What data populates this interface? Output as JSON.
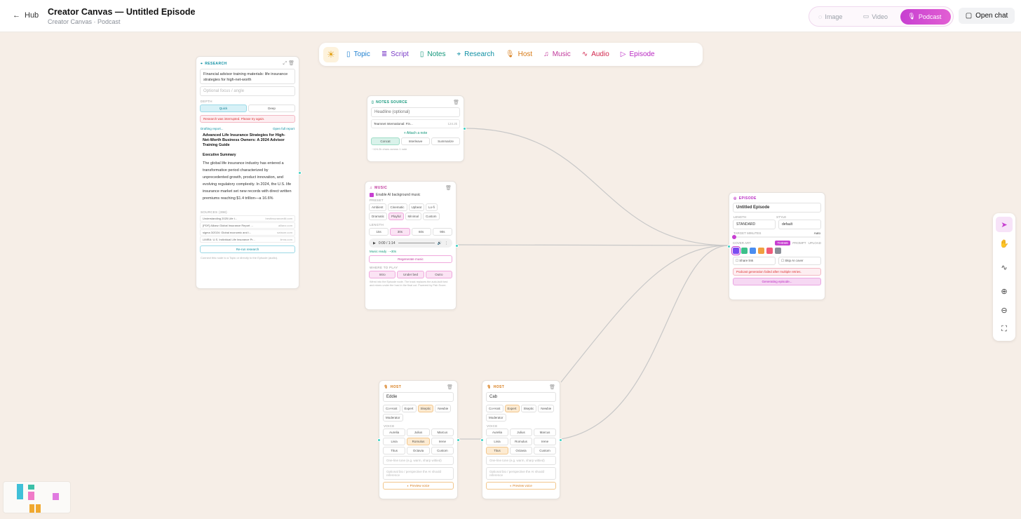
{
  "header": {
    "back_label": "Hub",
    "title": "Creator Canvas — Untitled Episode",
    "subtitle": "Creator Canvas · Podcast",
    "modes": [
      {
        "label": "Image"
      },
      {
        "label": "Video"
      },
      {
        "label": "Podcast"
      }
    ],
    "open_chat": "Open chat"
  },
  "toolbar": {
    "items": [
      {
        "label": "Topic",
        "color": "#1e7fd0"
      },
      {
        "label": "Script",
        "color": "#7a3cc7"
      },
      {
        "label": "Notes",
        "color": "#12967a"
      },
      {
        "label": "Research",
        "color": "#0e8fa3"
      },
      {
        "label": "Host",
        "color": "#d77a16"
      },
      {
        "label": "Music",
        "color": "#c0389b"
      },
      {
        "label": "Audio",
        "color": "#d1264d"
      },
      {
        "label": "Episode",
        "color": "#b928c2"
      }
    ]
  },
  "research": {
    "label": "RESEARCH",
    "topic": "Financial advisor training materials: life insurance strategies for high-net-worth",
    "optional": "Optional focus / angle",
    "depth_label": "DEPTH",
    "depth": [
      "Quick",
      "Deep"
    ],
    "error": "Research was interrupted. Please try again.",
    "drafting": "Drafting report...",
    "open_full": "Open full report",
    "report_title": "Advanced Life Insurance Strategies for High-Net-Worth Business Owners: A 2024 Advisor Training Guide",
    "exec": "Executive Summary",
    "body": "The global life insurance industry has entered a transformative period characterized by unprecedented growth, product innovation, and evolving regulatory complexity. In 2024, the U.S. life insurance market set new records with direct written premiums reaching $1.4 trillion—a 16.6%",
    "sources_label": "SOURCES (398)",
    "sources": [
      {
        "t": "Understanding 2025 Life I...",
        "d": "bestinsurancediii.com"
      },
      {
        "t": "[PDF] Allianz Global Insurance Report ...",
        "d": "allianz.com"
      },
      {
        "t": "sigma 3/2024: Global economic and i...",
        "d": "swissre.com"
      },
      {
        "t": "LIMRA: U.S. Individual Life Insurance Pr...",
        "d": "limra.com"
      }
    ],
    "rerun": "Re-run research",
    "foot": "Connect this node to a Topic or directly to the Episode (audio)."
  },
  "notes": {
    "label": "NOTES SOURCE",
    "headline": "Headline (optional)",
    "file": "Teamnet International: Fin...",
    "file_size": "124.2k",
    "attach": "Attach a note",
    "modes": [
      "Concat",
      "Interleave",
      "Summarize"
    ],
    "foot": "~124.2k chars across 1 note"
  },
  "music": {
    "label": "MUSIC",
    "enable": "Enable AI background music",
    "preset_label": "PRESET",
    "presets": [
      "Ambient",
      "Cinematic",
      "Upbeat",
      "Lo-fi",
      "Dramatic",
      "Playful",
      "Minimal",
      "Custom"
    ],
    "length_label": "LENGTH",
    "lengths": [
      "15s",
      "30s",
      "60s",
      "90s"
    ],
    "time": "0:00 / 1:14",
    "ready": "Music ready · ~30s",
    "regen": "Regenerate music",
    "where_label": "WHERE TO PLAY",
    "where": [
      "Intro",
      "Under bed",
      "Outro"
    ],
    "foot": "Wired into the Episode node. The track replaces the auto-built bed and mixes under the host in the final cut. Powered by Fish Score."
  },
  "episode": {
    "label": "EPISODE",
    "title": "Untitled Episode",
    "length_label": "LENGTH",
    "style_label": "STYLE",
    "length": "STANDARD",
    "style": "default",
    "target_label": "TARGET MINUTES",
    "target": "Auto",
    "cover_label": "COVER ART",
    "cover_tabs": [
      "THEME",
      "PROMPT",
      "UPLOAD"
    ],
    "swatches": [
      "#7a4cf0",
      "#3cc08a",
      "#4a8df0",
      "#f0a040",
      "#f05a7a",
      "#8a8f98"
    ],
    "share": "Share link",
    "skip": "Skip AI cover",
    "error": "Podcast generation failed after multiple retries.",
    "generating": "Generating episode..."
  },
  "host1": {
    "label": "HOST",
    "name": "Eddie",
    "roles": [
      "Co-Host",
      "Expert",
      "Skeptic",
      "Newbie",
      "Moderator"
    ],
    "voice_label": "VOICE",
    "voices": [
      "Aurelia",
      "Julius",
      "Marcus",
      "Livia",
      "Romulus",
      "Irene",
      "Titus",
      "Octavia",
      "Custom"
    ],
    "tone": "One-line tone (e.g. warm, sharp wittied)",
    "bio": "Optional bio / perspective the AI should reference",
    "preview": "Preview voice"
  },
  "host2": {
    "label": "HOST",
    "name": "Cab",
    "roles": [
      "Co-Host",
      "Expert",
      "Skeptic",
      "Newbie",
      "Moderator"
    ],
    "voice_label": "VOICE",
    "voices": [
      "Aurelia",
      "Julius",
      "Marcus",
      "Livia",
      "Romulus",
      "Irene",
      "Titus",
      "Octavia",
      "Custom"
    ],
    "tone": "One-line tone (e.g. warm, sharp wittied)",
    "bio": "Optional bio / perspective the AI should reference",
    "preview": "Preview voice"
  },
  "colors": {
    "accent": "#c73fd1",
    "teal": "#3fd1c3",
    "error": "#d33"
  }
}
